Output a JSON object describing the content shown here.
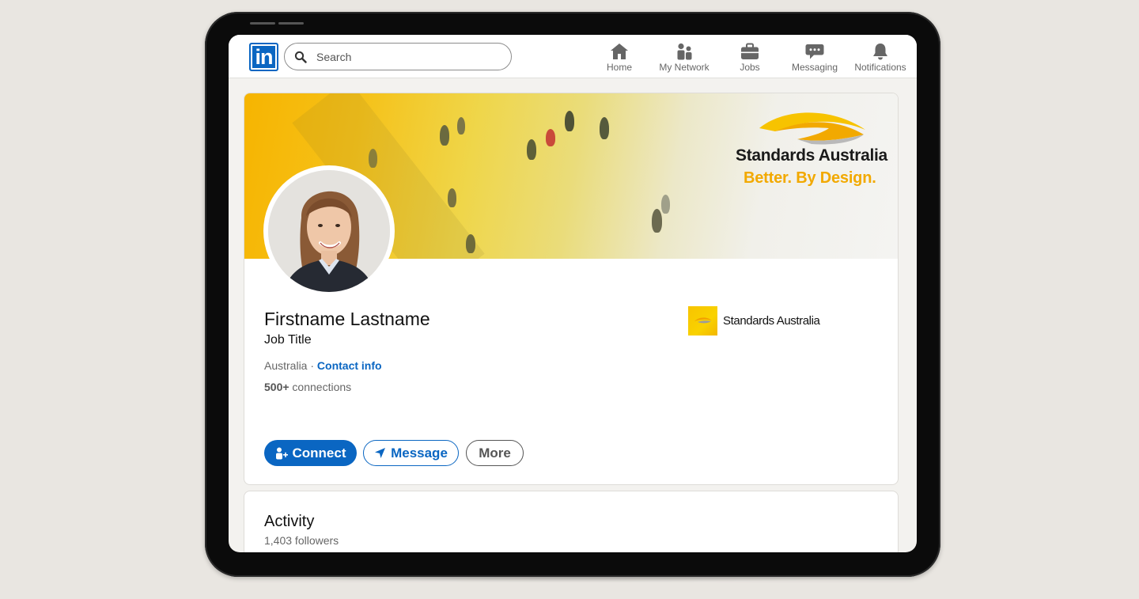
{
  "nav": {
    "logo_text": "in",
    "search_placeholder": "Search",
    "items": [
      {
        "label": "Home",
        "icon": "home-icon"
      },
      {
        "label": "My Network",
        "icon": "network-icon"
      },
      {
        "label": "Jobs",
        "icon": "briefcase-icon"
      },
      {
        "label": "Messaging",
        "icon": "chat-icon"
      },
      {
        "label": "Notifications",
        "icon": "bell-icon"
      }
    ]
  },
  "banner": {
    "org_name": "Standards Australia",
    "tagline": "Better. By Design."
  },
  "profile": {
    "name": "Firstname Lastname",
    "job_title": "Job Title",
    "location": "Australia",
    "separator": " · ",
    "contact_link": "Contact info",
    "connections_count": "500+",
    "connections_label": " connections",
    "company_name": "Standards Australia"
  },
  "actions": {
    "connect": "Connect",
    "message": "Message",
    "more": "More"
  },
  "activity": {
    "title": "Activity",
    "followers": "1,403 followers"
  },
  "colors": {
    "brand_blue": "#0a66c2",
    "brand_yellow": "#f2a900",
    "page_bg": "#f3f2ef"
  }
}
